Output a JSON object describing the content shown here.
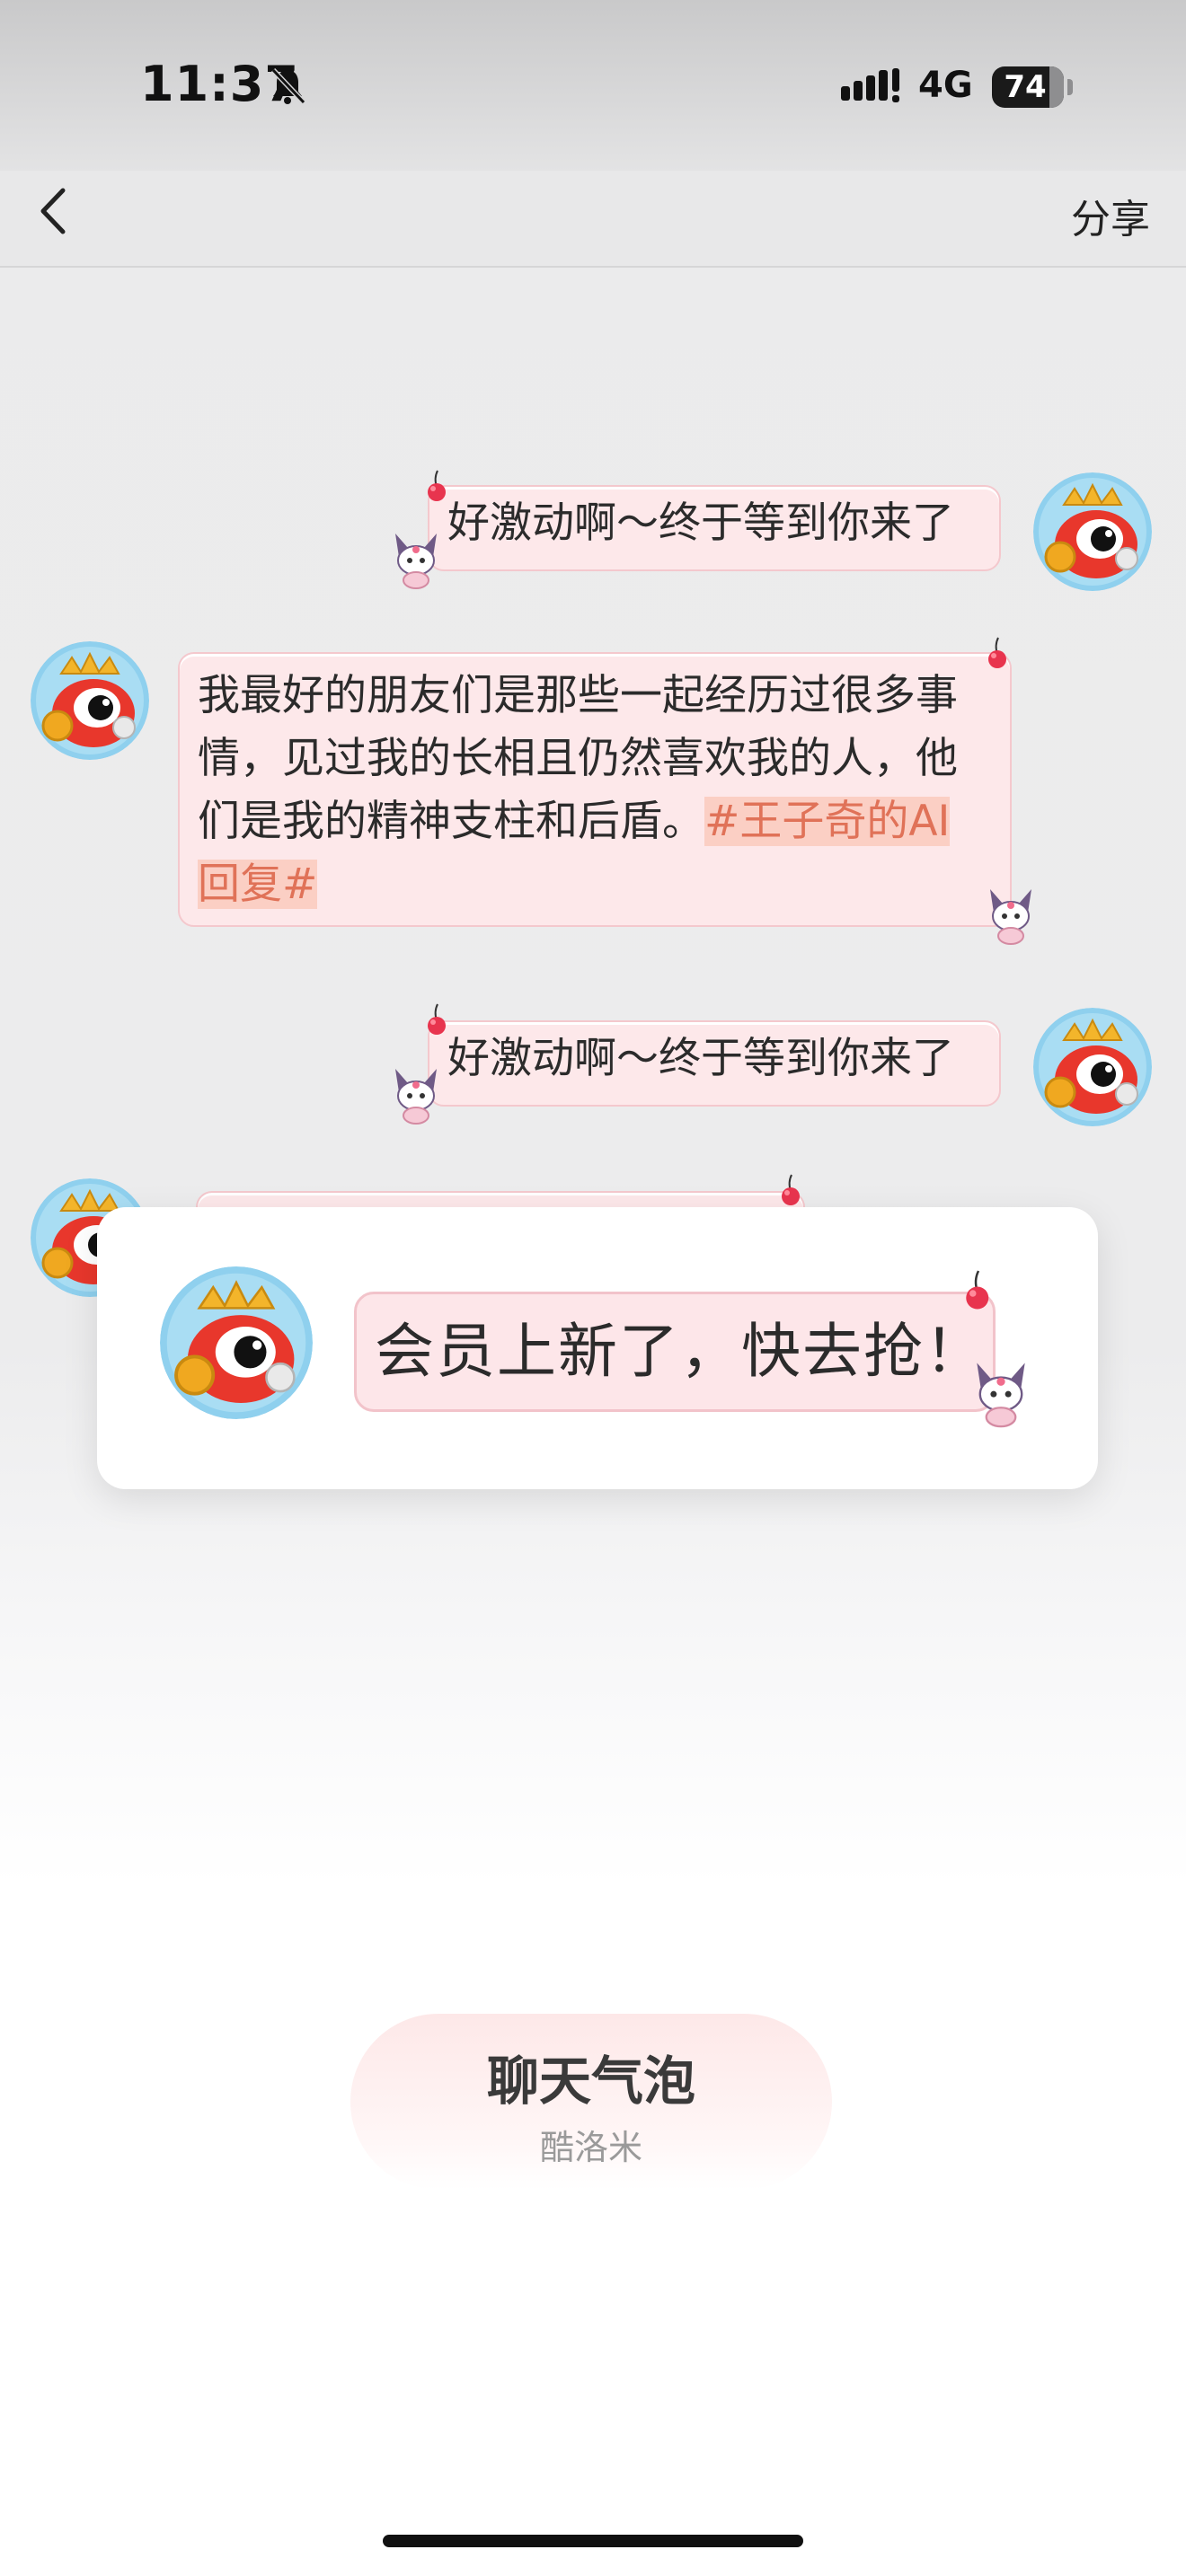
{
  "status_bar": {
    "time": "11:37",
    "network": "4G",
    "battery": "74"
  },
  "nav": {
    "share_label": "分享"
  },
  "messages": [
    {
      "side": "right",
      "text": "好激动啊～终于等到你来了"
    },
    {
      "side": "left",
      "text": "我最好的朋友们是那些一起经历过很多事情，见过我的长相且仍然喜欢我的人，他们是我的精神支柱和后盾。",
      "tag": "#王子奇的AI回复#"
    },
    {
      "side": "right",
      "text": "好激动啊～终于等到你来了"
    }
  ],
  "popup": {
    "text": "会员上新了，快去抢！"
  },
  "bubble_item": {
    "title": "聊天气泡",
    "author": "酷洛米"
  },
  "icons": [
    "back-arrow-icon",
    "bell-slash-icon",
    "signal-icon",
    "battery-icon",
    "cherry-icon",
    "kuromi-sticker-icon",
    "avatar-icon"
  ],
  "colors": {
    "bubble_fill": "#fde8ea",
    "bubble_border": "#f4c8cd",
    "tag_color": "#e07258",
    "popup_bg": "#ffffff"
  }
}
